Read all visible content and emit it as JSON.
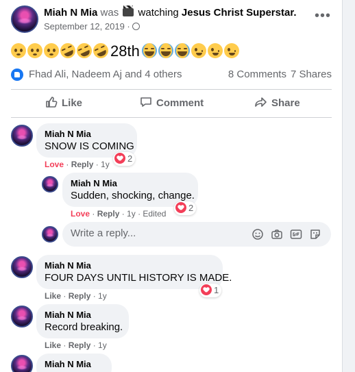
{
  "post": {
    "author": "Miah N Mia",
    "was": "was",
    "activity": "watching",
    "subject": "Jesus Christ Superstar.",
    "date": "September 12, 2019 ·",
    "text_mid": "28th",
    "icons": [
      "film-icon",
      "globe-icon",
      "more-options-icon"
    ]
  },
  "reactions": {
    "names": "Fhad Ali, Nadeem Aj and 4 others",
    "comments": "8 Comments",
    "shares": "7 Shares"
  },
  "actions": {
    "like": "Like",
    "comment": "Comment",
    "share": "Share"
  },
  "comments": [
    {
      "name": "Miah N Mia",
      "text": "SNOW IS COMING",
      "love": "Love",
      "reply": "Reply",
      "time": "1y",
      "hearts": "2"
    },
    {
      "name": "Miah N Mia",
      "text": "Sudden, shocking, change.",
      "love": "Love",
      "reply": "Reply",
      "time": "1y",
      "edited": "Edited",
      "hearts": "2"
    },
    {
      "name": "Miah N Mia",
      "text": "FOUR DAYS UNTIL HISTORY IS MADE.",
      "like": "Like",
      "reply": "Reply",
      "time": "1y",
      "hearts": "1"
    },
    {
      "name": "Miah N Mia",
      "text": "Record breaking.",
      "like": "Like",
      "reply": "Reply",
      "time": "1y"
    },
    {
      "name": "Miah N Mia"
    }
  ],
  "reply_input": {
    "placeholder": "Write a reply..."
  },
  "colors": {
    "brand_blue": "#1877f2",
    "love_red": "#f33e58",
    "muted": "#65676b",
    "bubble": "#f0f2f5"
  }
}
